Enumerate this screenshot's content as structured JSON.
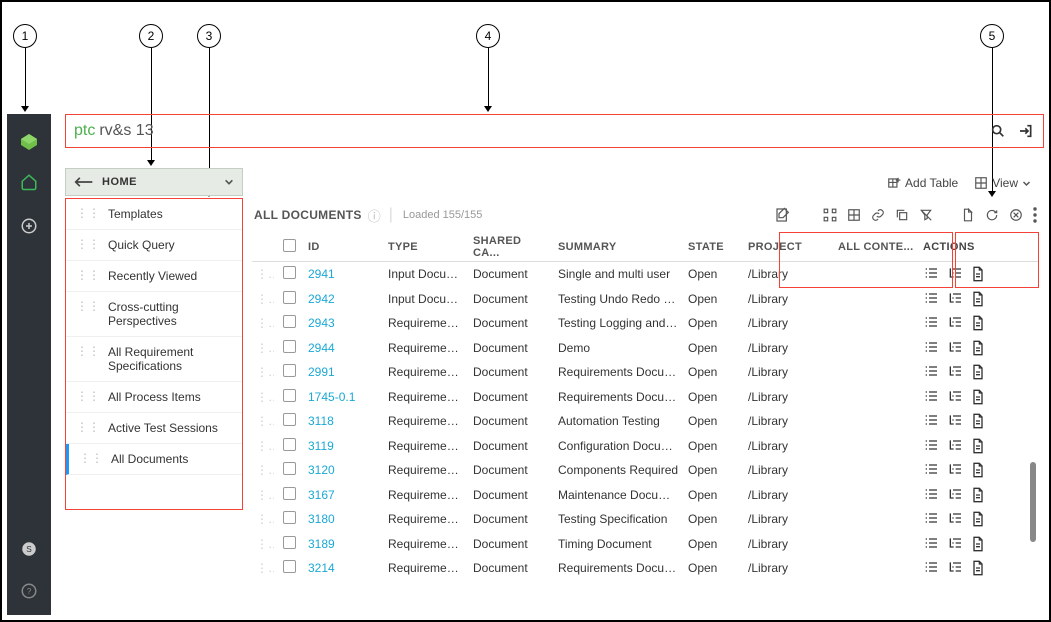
{
  "callouts": [
    "1",
    "2",
    "3",
    "4",
    "5"
  ],
  "brand": {
    "ptc": "ptc",
    "rvs": "rv&s 13"
  },
  "homebar": {
    "label": "HOME"
  },
  "viewbar": {
    "addTable": "Add Table",
    "view": "View"
  },
  "nav": {
    "items": [
      {
        "label": "Templates"
      },
      {
        "label": "Quick Query"
      },
      {
        "label": "Recently Viewed"
      },
      {
        "label": "Cross-cutting Perspectives"
      },
      {
        "label": "All Requirement Specifications"
      },
      {
        "label": "All Process Items"
      },
      {
        "label": "Active Test Sessions"
      },
      {
        "label": "All Documents",
        "active": true
      }
    ]
  },
  "content": {
    "title": "ALL DOCUMENTS",
    "loaded": "Loaded 155/155"
  },
  "table": {
    "headers": {
      "id": "ID",
      "type": "TYPE",
      "shared": "SHARED CA...",
      "summary": "SUMMARY",
      "state": "STATE",
      "project": "PROJECT",
      "content": "ALL CONTE...",
      "actions": "ACTIONS"
    },
    "rows": [
      {
        "id": "2941",
        "type": "Input Docum...",
        "shared": "Document",
        "summary": "Single and multi user",
        "state": "Open",
        "project": "/Library"
      },
      {
        "id": "2942",
        "type": "Input Docum...",
        "shared": "Document",
        "summary": "Testing Undo Redo op...",
        "state": "Open",
        "project": "/Library"
      },
      {
        "id": "2943",
        "type": "Requirement ...",
        "shared": "Document",
        "summary": "Testing Logging and at...",
        "state": "Open",
        "project": "/Library"
      },
      {
        "id": "2944",
        "type": "Requirement ...",
        "shared": "Document",
        "summary": "Demo",
        "state": "Open",
        "project": "/Library"
      },
      {
        "id": "2991",
        "type": "Requirement ...",
        "shared": "Document",
        "summary": "Requirements Docum...",
        "state": "Open",
        "project": "/Library"
      },
      {
        "id": "1745-0.1",
        "type": "Requirement ...",
        "shared": "Document",
        "summary": "Requirements Docum...",
        "state": "Open",
        "project": "/Library"
      },
      {
        "id": "3118",
        "type": "Requirement ...",
        "shared": "Document",
        "summary": "Automation Testing",
        "state": "Open",
        "project": "/Library"
      },
      {
        "id": "3119",
        "type": "Requirement ...",
        "shared": "Document",
        "summary": "Configuration Docume...",
        "state": "Open",
        "project": "/Library"
      },
      {
        "id": "3120",
        "type": "Requirement ...",
        "shared": "Document",
        "summary": "Components Required",
        "state": "Open",
        "project": "/Library"
      },
      {
        "id": "3167",
        "type": "Requirement ...",
        "shared": "Document",
        "summary": "Maintenance Docume...",
        "state": "Open",
        "project": "/Library"
      },
      {
        "id": "3180",
        "type": "Requirement ...",
        "shared": "Document",
        "summary": "Testing Specification",
        "state": "Open",
        "project": "/Library"
      },
      {
        "id": "3189",
        "type": "Requirement ...",
        "shared": "Document",
        "summary": "Timing Document",
        "state": "Open",
        "project": "/Library"
      },
      {
        "id": "3214",
        "type": "Requirement ...",
        "shared": "Document",
        "summary": "Requirements Docum...",
        "state": "Open",
        "project": "/Library"
      }
    ]
  }
}
